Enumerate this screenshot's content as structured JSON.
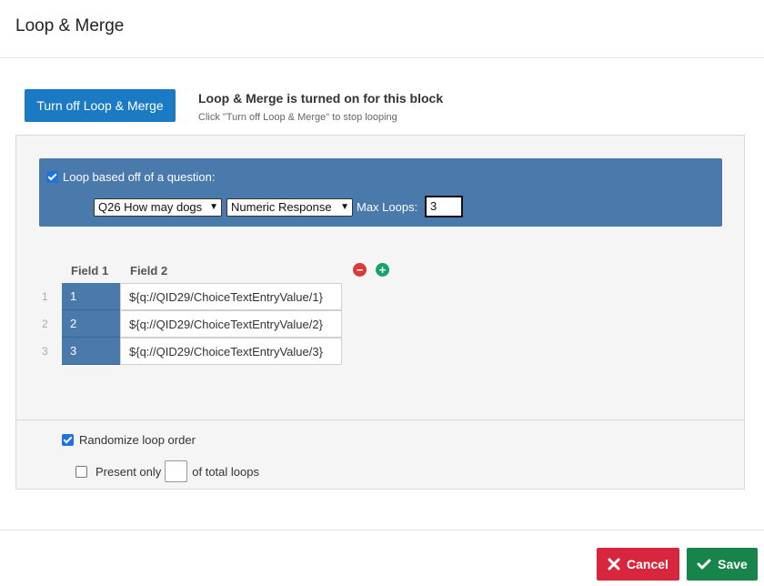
{
  "dialog": {
    "title": "Loop & Merge"
  },
  "toggle": {
    "button_label": "Turn off Loop & Merge",
    "status_title": "Loop & Merge is turned on for this block",
    "status_hint": "Click \"Turn off Loop & Merge\" to stop looping"
  },
  "loop_source": {
    "checkbox_label": "Loop based off of a question:",
    "checked": true,
    "question_select": "Q26 How may dogs",
    "response_select": "Numeric Response",
    "max_loops_label": "Max Loops:",
    "max_loops_value": "3"
  },
  "table": {
    "headers": [
      "Field 1",
      "Field 2"
    ],
    "rows": [
      {
        "num": "1",
        "field1": "1",
        "field2": "${q://QID29/ChoiceTextEntryValue/1}"
      },
      {
        "num": "2",
        "field1": "2",
        "field2": "${q://QID29/ChoiceTextEntryValue/2}"
      },
      {
        "num": "3",
        "field1": "3",
        "field2": "${q://QID29/ChoiceTextEntryValue/3}"
      }
    ],
    "remove_icon": "minus-circle-icon",
    "add_icon": "plus-circle-icon"
  },
  "options": {
    "randomize_label": "Randomize loop order",
    "randomize_checked": true,
    "present_only_label": "Present only",
    "present_only_checked": false,
    "present_only_value": "",
    "total_loops_label": "of total loops"
  },
  "footer": {
    "cancel_label": "Cancel",
    "save_label": "Save"
  },
  "colors": {
    "primary": "#1a7bc4",
    "loop_bar": "#4a79ab",
    "cancel": "#d7263d",
    "save": "#17854a"
  }
}
